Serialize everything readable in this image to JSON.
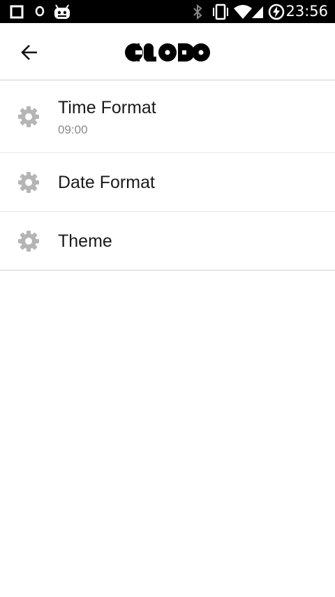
{
  "status_bar": {
    "time": "23:56",
    "icons": [
      "square-icon",
      "location-icon",
      "android-icon",
      "bluetooth-icon",
      "vibrate-icon",
      "wifi-icon",
      "signal-icon",
      "battery-charging-icon"
    ]
  },
  "app_bar": {
    "back_icon": "arrow-left-icon",
    "logo_text": "CLODO"
  },
  "settings": [
    {
      "title": "Time Format",
      "summary": "09:00",
      "icon": "gear-icon"
    },
    {
      "title": "Date Format",
      "icon": "gear-icon"
    },
    {
      "title": "Theme",
      "icon": "gear-icon"
    }
  ],
  "colors": {
    "status_bar_bg": "#000000",
    "background": "#ffffff",
    "title_text": "#1a1a1a",
    "summary_text": "#8a8a8a",
    "icon_gray": "#b5b5b5"
  }
}
